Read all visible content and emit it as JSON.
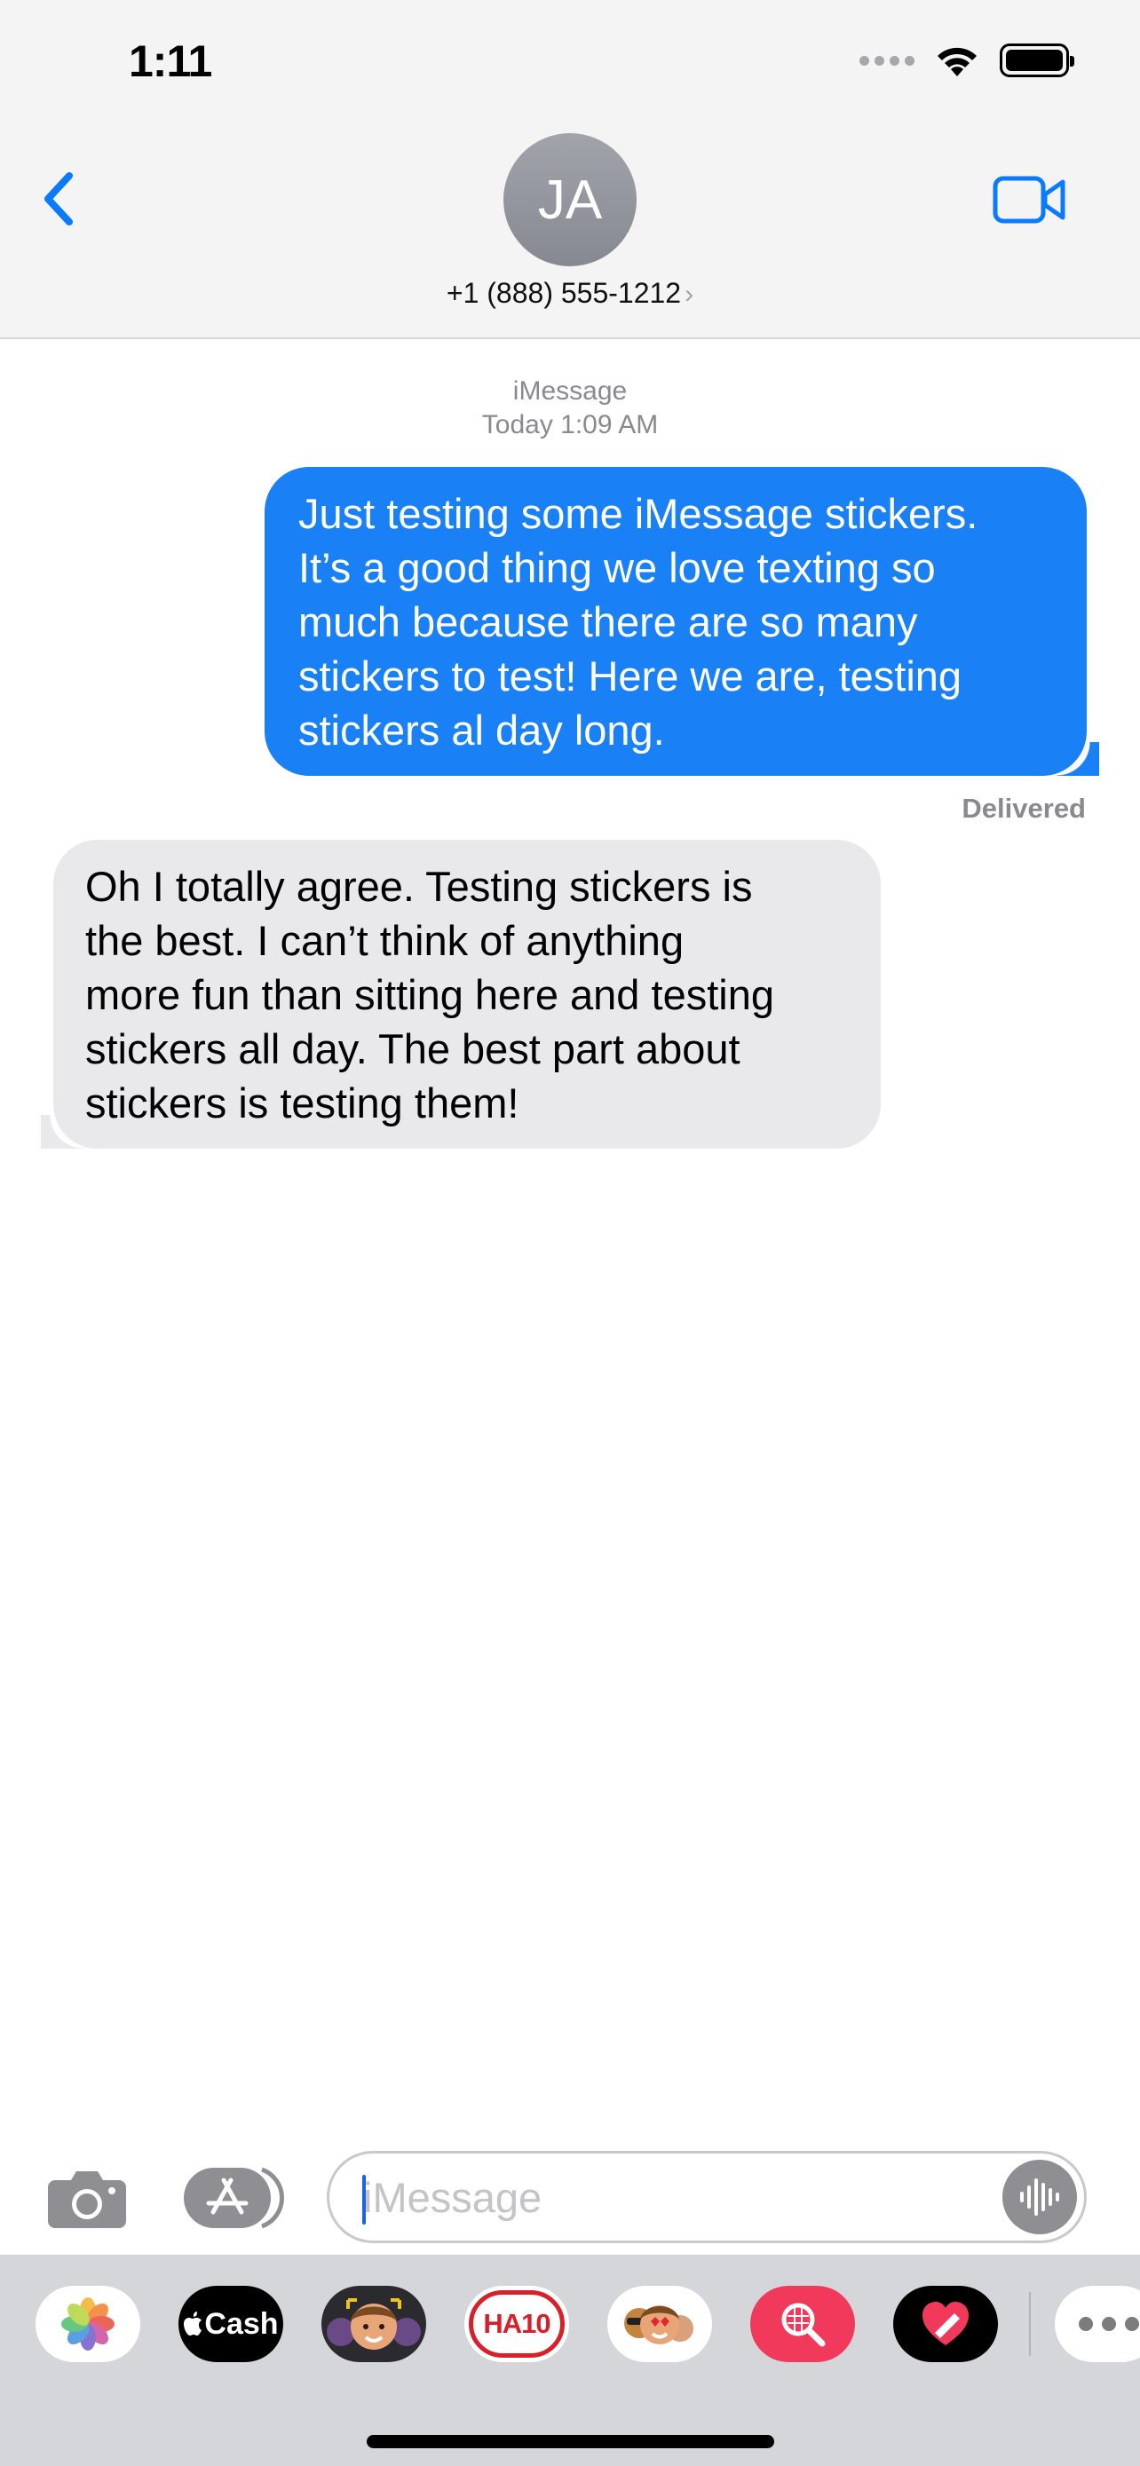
{
  "status_bar": {
    "time": "1:11",
    "icons": [
      "cellular-signal-icon",
      "wifi-icon",
      "battery-icon"
    ]
  },
  "header": {
    "back_icon": "chevron-left-icon",
    "avatar_initials": "JA",
    "contact_number": "+1 (888) 555-1212",
    "chevron": "›",
    "video_icon": "video-camera-icon"
  },
  "thread": {
    "service": "iMessage",
    "timestamp": "Today 1:09 AM",
    "messages": [
      {
        "direction": "outgoing",
        "lines": [
          "Just testing some iMessage stickers.",
          "It’s a good thing we love texting so",
          "much because there are so many",
          "stickers to test! Here we are, testing",
          "stickers al day long."
        ],
        "status": "Delivered"
      },
      {
        "direction": "incoming",
        "lines": [
          "Oh I totally agree. Testing stickers is",
          "the best. I can’t think of anything",
          "more fun than sitting here and testing",
          "stickers all day. The best part about",
          "stickers is testing them!"
        ]
      }
    ]
  },
  "input_bar": {
    "camera_icon": "camera-icon",
    "apps_icon": "app-store-icon",
    "placeholder": "iMessage",
    "audio_icon": "audio-waveform-icon"
  },
  "app_drawer": {
    "apps": [
      {
        "name": "photos-app-icon"
      },
      {
        "name": "apple-cash-app",
        "label": "Cash"
      },
      {
        "name": "memoji-app-icon"
      },
      {
        "name": "ha10-app",
        "label": "HA10"
      },
      {
        "name": "memoji-stickers-app-icon"
      },
      {
        "name": "search-images-app-icon"
      },
      {
        "name": "digital-touch-app-icon"
      },
      {
        "name": "more-apps-icon"
      }
    ]
  },
  "colors": {
    "accent": "#0a7aff",
    "outgoing_bubble": "#1a80f5",
    "incoming_bubble": "#e9e9eb",
    "header_bg": "#f4f4f5",
    "drawer_bg": "#d5d6da"
  }
}
